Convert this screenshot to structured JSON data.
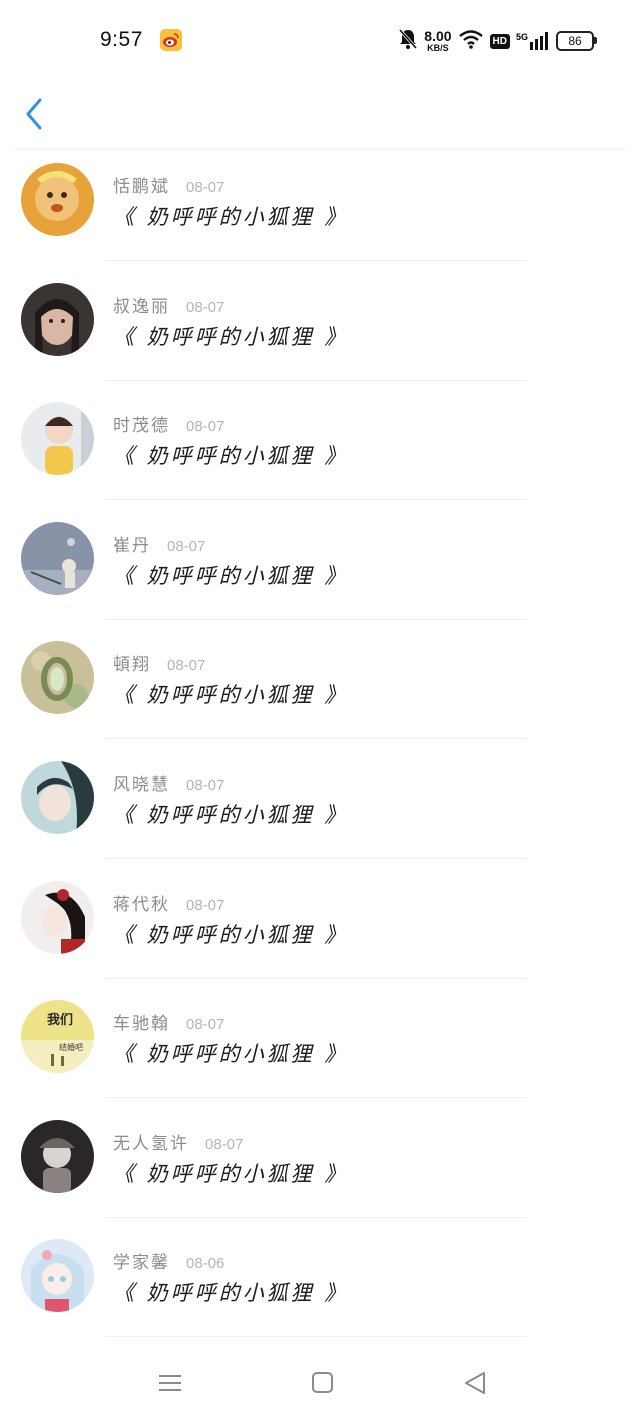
{
  "status": {
    "time": "9:57",
    "net_speed": "8.00",
    "net_unit": "KB/S",
    "hd": "HD",
    "signal": "5G",
    "battery": "86"
  },
  "list": [
    {
      "name": "恬鹏斌",
      "date": "08-07",
      "title": "《 奶呼呼的小狐狸 》",
      "avatar_bg": "#e8a23a",
      "avatar_fg": "#c4541a"
    },
    {
      "name": "叔逸丽",
      "date": "08-07",
      "title": "《 奶呼呼的小狐狸 》",
      "avatar_bg": "#3a3432",
      "avatar_fg": "#d9b7a4"
    },
    {
      "name": "时茂德",
      "date": "08-07",
      "title": "《 奶呼呼的小狐狸 》",
      "avatar_bg": "#e9ecef",
      "avatar_fg": "#f2c94c"
    },
    {
      "name": "崔丹",
      "date": "08-07",
      "title": "《 奶呼呼的小狐狸 》",
      "avatar_bg": "#8893a7",
      "avatar_fg": "#e8e4dc"
    },
    {
      "name": "頓翔",
      "date": "08-07",
      "title": "《 奶呼呼的小狐狸 》",
      "avatar_bg": "#c9c09a",
      "avatar_fg": "#7a8a55"
    },
    {
      "name": "风晓慧",
      "date": "08-07",
      "title": "《 奶呼呼的小狐狸 》",
      "avatar_bg": "#bfd8dc",
      "avatar_fg": "#2a3b40"
    },
    {
      "name": "蒋代秋",
      "date": "08-07",
      "title": "《 奶呼呼的小狐狸 》",
      "avatar_bg": "#f3eeee",
      "avatar_fg": "#b3262a"
    },
    {
      "name": "车驰翰",
      "date": "08-07",
      "title": "《 奶呼呼的小狐狸 》",
      "avatar_bg": "#efe38a",
      "avatar_fg": "#6f6a3a",
      "avatar_text": "我们",
      "avatar_subtext": "结婚吧"
    },
    {
      "name": "无人氢许",
      "date": "08-07",
      "title": "《 奶呼呼的小狐狸 》",
      "avatar_bg": "#2b2727",
      "avatar_fg": "#d8d3cf"
    },
    {
      "name": "学家馨",
      "date": "08-06",
      "title": "《 奶呼呼的小狐狸 》",
      "avatar_bg": "#dfe9f5",
      "avatar_fg": "#8ecfe6"
    }
  ],
  "colors": {
    "accent": "#2e93e0",
    "name_gray": "#8c8c8c",
    "date_gray": "#b5b5b5",
    "title": "#1c1c1c"
  }
}
